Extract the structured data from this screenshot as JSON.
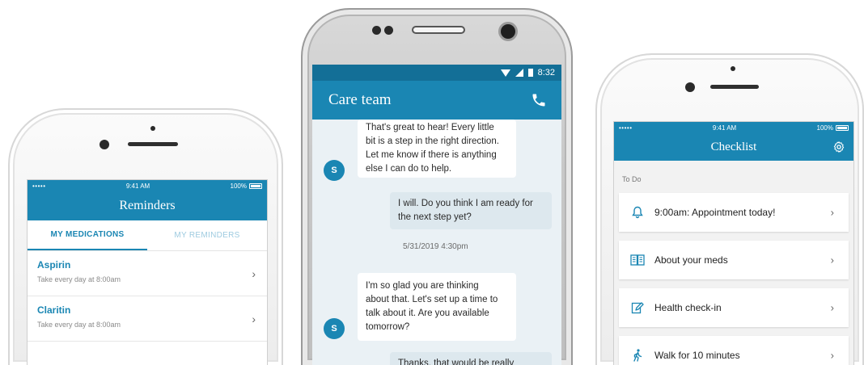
{
  "colors": {
    "brand": "#1a86b3",
    "brand_dark": "#136f97",
    "muted_tab": "#9ecbe0"
  },
  "reminders_phone": {
    "status": {
      "signal": "•••••",
      "time": "9:41 AM",
      "battery": "100%"
    },
    "title": "Reminders",
    "tabs": [
      {
        "label": "MY MEDICATIONS",
        "active": true
      },
      {
        "label": "MY REMINDERS",
        "active": false
      }
    ],
    "medications": [
      {
        "name": "Aspirin",
        "desc": "Take every day at 8:00am"
      },
      {
        "name": "Claritin",
        "desc": "Take every day at 8:00am"
      }
    ]
  },
  "care_phone": {
    "status": {
      "time": "8:32"
    },
    "title": "Care team",
    "icons": {
      "call": "phone-icon"
    },
    "messages": [
      {
        "from": "care",
        "avatar": "S",
        "lines": [
          "That's great to hear! Every little",
          "bit is a step in the right direction.",
          "Let me know if there is anything",
          "else I can do to help."
        ]
      },
      {
        "from": "me",
        "lines": [
          "I will. Do you think I am ready for",
          "the next step yet?"
        ]
      },
      {
        "from": "care",
        "avatar": "S",
        "lines": [
          "I'm so glad you are thinking",
          "about that. Let's set up a time to",
          "talk about it. Are you available",
          "tomorrow?"
        ]
      },
      {
        "from": "me",
        "lines": [
          "Thanks, that would be really"
        ]
      }
    ],
    "timestamp": "5/31/2019 4:30pm"
  },
  "checklist_phone": {
    "status": {
      "signal": "•••••",
      "time": "9:41 AM",
      "battery": "100%"
    },
    "title": "Checklist",
    "section": "To Do",
    "items": [
      {
        "label": "9:00am: Appointment today!",
        "icon": "bell-icon"
      },
      {
        "label": "About your meds",
        "icon": "book-icon"
      },
      {
        "label": "Health check-in",
        "icon": "pencil-note-icon"
      },
      {
        "label": "Walk for 10 minutes",
        "icon": "walking-person-icon"
      }
    ]
  }
}
